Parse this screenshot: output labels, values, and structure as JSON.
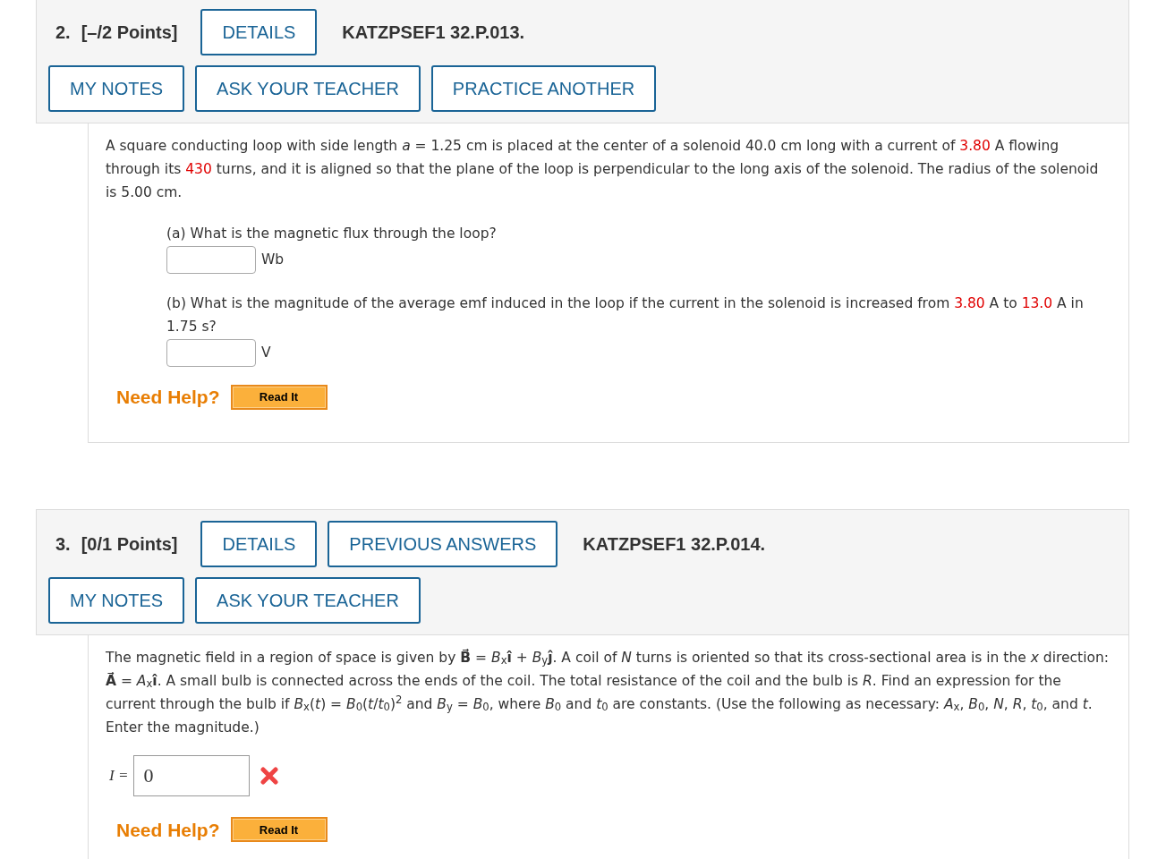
{
  "problems": [
    {
      "number": "2.",
      "points": "[–/2 Points]",
      "header_buttons": [
        "DETAILS"
      ],
      "code": "KATZPSEF1 32.P.013.",
      "tool_buttons": [
        "MY NOTES",
        "ASK YOUR TEACHER",
        "PRACTICE ANOTHER"
      ],
      "statement": [
        {
          "kind": "plain",
          "text": "A square conducting loop with side length  *a* = 1.25 cm  is placed at the center of a solenoid 40.0 cm long with a current of "
        },
        {
          "kind": "given",
          "text": "3.80"
        },
        {
          "kind": "plain",
          "text": " A flowing through its "
        },
        {
          "kind": "given",
          "text": "430"
        },
        {
          "kind": "plain",
          "text": " turns, and it is aligned so that the plane of the loop is perpendicular to the long axis of the solenoid. The radius of the solenoid is 5.00 cm."
        }
      ],
      "parts": [
        {
          "question": [
            {
              "kind": "plain",
              "text": "(a) What is the magnetic flux through the loop?"
            }
          ],
          "unit": "Wb"
        },
        {
          "question": [
            {
              "kind": "plain",
              "text": "(b) What is the magnitude of the average emf induced in the loop if the current in the solenoid is increased from "
            },
            {
              "kind": "given",
              "text": "3.80"
            },
            {
              "kind": "plain",
              "text": " A to "
            },
            {
              "kind": "given",
              "text": "13.0"
            },
            {
              "kind": "plain",
              "text": " A in 1.75 s?"
            }
          ],
          "unit": "V"
        }
      ],
      "help": {
        "label": "Need Help?",
        "buttons": [
          "Read It"
        ]
      }
    },
    {
      "number": "3.",
      "points": "[0/1 Points]",
      "header_buttons": [
        "DETAILS",
        "PREVIOUS ANSWERS"
      ],
      "code": "KATZPSEF1 32.P.014.",
      "tool_buttons": [
        "MY NOTES",
        "ASK YOUR TEACHER"
      ],
      "statement": [
        {
          "kind": "plain",
          "text": "The magnetic field in a region of space is given by  **B⃗** = *B*$_{x}$**î** + *B*$_{y}$**ĵ**.  A coil of *N* turns is oriented so that its cross-sectional area is in the *x* direction:  **A⃗** = *A*$_{x}$**î**.  A small bulb is connected across the ends of the coil. The total resistance of the coil and the bulb is *R*. Find an expression for the current through the bulb if  *B*$_{x}$(*t*) = *B*$_{0}$(*t*/*t*$_{0}$)$^{2}$  and  *B*$_{y}$ = *B*$_{0}$,  where *B*$_{0}$ and *t*$_{0}$ are constants. (Use the following as necessary: *A*$_{x}$, *B*$_{0}$, *N*, *R*, *t*$_{0}$, and *t*. Enter the magnitude.)"
        }
      ],
      "answer": {
        "label": "I =",
        "value": "0",
        "correct": false
      },
      "help": {
        "label": "Need Help?",
        "buttons": [
          "Read It"
        ]
      }
    }
  ]
}
